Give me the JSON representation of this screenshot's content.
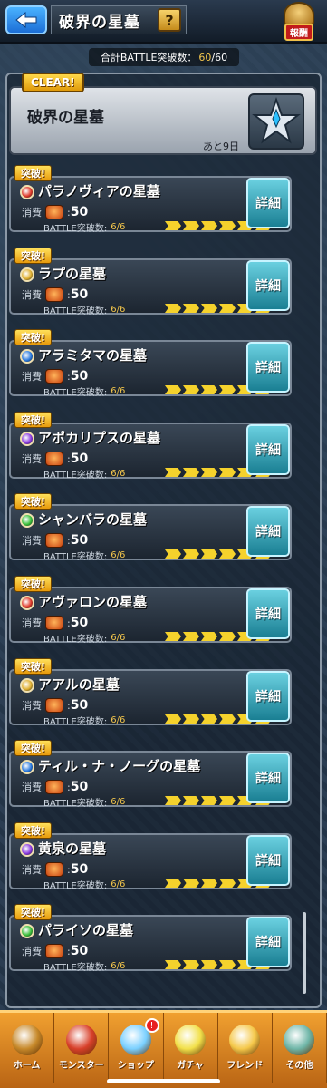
{
  "header": {
    "title": "破界の星墓",
    "help_label": "?",
    "reward_label": "報酬"
  },
  "battle_counter": {
    "label": "合計BATTLE突破数：",
    "current": "60",
    "total": "/60"
  },
  "top_card": {
    "badge": "CLEAR!",
    "name": "破界の星墓",
    "days_left": "あと9日"
  },
  "rows": [
    {
      "badge": "突破!",
      "name": "パラノヴィアの星墓",
      "element": "#e03a2a",
      "cost_label": "消費",
      "cost": "50",
      "progress_label": "BATTLE突破数:",
      "progress": "6/6",
      "detail": "詳細"
    },
    {
      "badge": "突破!",
      "name": "ラプの星墓",
      "element": "#e0b030",
      "cost_label": "消費",
      "cost": "50",
      "progress_label": "BATTLE突破数:",
      "progress": "6/6",
      "detail": "詳細"
    },
    {
      "badge": "突破!",
      "name": "アラミタマの星墓",
      "element": "#2a7ae0",
      "cost_label": "消費",
      "cost": "50",
      "progress_label": "BATTLE突破数:",
      "progress": "6/6",
      "detail": "詳細"
    },
    {
      "badge": "突破!",
      "name": "アポカリプスの星墓",
      "element": "#8a3ae0",
      "cost_label": "消費",
      "cost": "50",
      "progress_label": "BATTLE突破数:",
      "progress": "6/6",
      "detail": "詳細"
    },
    {
      "badge": "突破!",
      "name": "シャンバラの星墓",
      "element": "#3ac03a",
      "cost_label": "消費",
      "cost": "50",
      "progress_label": "BATTLE突破数:",
      "progress": "6/6",
      "detail": "詳細"
    },
    {
      "badge": "突破!",
      "name": "アヴァロンの星墓",
      "element": "#e03a2a",
      "cost_label": "消費",
      "cost": "50",
      "progress_label": "BATTLE突破数:",
      "progress": "6/6",
      "detail": "詳細"
    },
    {
      "badge": "突破!",
      "name": "アアルの星墓",
      "element": "#e0b030",
      "cost_label": "消費",
      "cost": "50",
      "progress_label": "BATTLE突破数:",
      "progress": "6/6",
      "detail": "詳細"
    },
    {
      "badge": "突破!",
      "name": "ティル・ナ・ノーグの星墓",
      "element": "#2a7ae0",
      "cost_label": "消費",
      "cost": "50",
      "progress_label": "BATTLE突破数:",
      "progress": "6/6",
      "detail": "詳細"
    },
    {
      "badge": "突破!",
      "name": "黄泉の星墓",
      "element": "#8a3ae0",
      "cost_label": "消費",
      "cost": "50",
      "progress_label": "BATTLE突破数:",
      "progress": "6/6",
      "detail": "詳細"
    },
    {
      "badge": "突破!",
      "name": "パライソの星墓",
      "element": "#3ac03a",
      "cost_label": "消費",
      "cost": "50",
      "progress_label": "BATTLE突破数:",
      "progress": "6/6",
      "detail": "詳細"
    }
  ],
  "bottom_nav": [
    {
      "label": "ホーム",
      "icon": "home-icon",
      "color": "#c7892a"
    },
    {
      "label": "モンスター",
      "icon": "monster-icon",
      "color": "#d8402a"
    },
    {
      "label": "ショップ",
      "icon": "shop-orb-icon",
      "color": "#7ad0ff",
      "alert": "!"
    },
    {
      "label": "ガチャ",
      "icon": "gacha-icon",
      "color": "#f2e04a"
    },
    {
      "label": "フレンド",
      "icon": "friend-icon",
      "color": "#f5c84a"
    },
    {
      "label": "その他",
      "icon": "other-icon",
      "color": "#6fb6a8"
    }
  ]
}
